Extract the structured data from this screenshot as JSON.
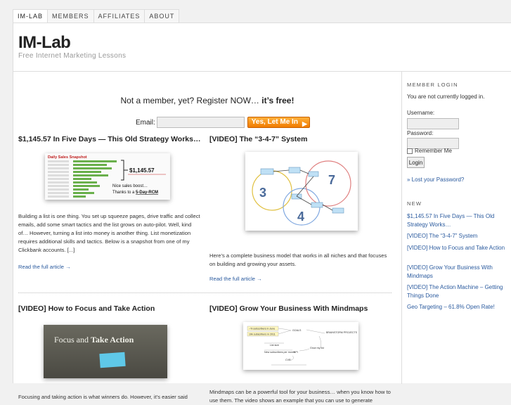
{
  "nav": {
    "tabs": [
      "IM-LAB",
      "MEMBERS",
      "AFFILIATES",
      "ABOUT"
    ]
  },
  "site": {
    "title": "IM-Lab",
    "description": "Free Internet Marketing Lessons"
  },
  "signup": {
    "text_prefix": "Not a member, yet? Register NOW… ",
    "text_bold": "it’s free!",
    "email_label": "Email:",
    "email_value": "",
    "button_label": "Yes, Let Me In",
    "button_icon": "arrow-right-icon"
  },
  "posts": [
    {
      "title": "$1,145.57 In Five Days — This Old Strategy Works…",
      "excerpt": "Building a list is one thing. You set up squeeze pages, drive traffic and collect emails, add some smart tactics and the list grows on auto-pilot. Well, kind of… However, turning a list into money is another thing. List monetization requires additional skills and tactics. Below is a snapshot from one of my Clickbank accounts. [...]",
      "read_more": "Read the full article →",
      "image": {
        "heading": "Daily Sales Snapshot",
        "amount": "$1,145.57",
        "note_line1": "Nice sales boost…",
        "note_line2": "Thanks to a ",
        "note_link": "5-Day-RCM"
      }
    },
    {
      "title": "[VIDEO] The “3-4-7” System",
      "excerpt": "Here’s a complete business model that works in all niches and that focuses on building and growing your assets.",
      "read_more": "Read the full article →",
      "image": {
        "n1": "3",
        "n2": "4",
        "n3": "7"
      }
    },
    {
      "title": "[VIDEO] How to Focus and Take Action",
      "excerpt": "Focusing and taking action is what winners do. However, it’s easier said",
      "read_more": "",
      "image": {
        "text_plain": "Focus and ",
        "text_bold": "Take Action"
      }
    },
    {
      "title": "[VIDEO] Grow Your Business With Mindmaps",
      "excerpt": "Mindmaps can be a powerful tool for your business… when you know how to use them. The video shows an example that you can use to generate",
      "read_more": "",
      "image": {
        "nodes": [
          "~% subscribers in June",
          "10k subscribers in 2011",
          "GOALS",
          "BRAINSTORM PROJECTS",
          "List size",
          "New subscribers per month",
          "Grow my list",
          "KPI",
          "CVR"
        ]
      }
    }
  ],
  "sidebar": {
    "login_heading": "Member Login",
    "login_status": "You are not currently logged in.",
    "username_label": "Username:",
    "password_label": "Password:",
    "remember_label": "Remember Me",
    "login_button": "Login",
    "lost_password": "» Lost your Password?",
    "new_heading": "New",
    "new_links": [
      "$1,145.57 In Five Days — This Old Strategy Works…",
      "[VIDEO] The “3-4-7” System",
      "[VIDEO] How to Focus and Take Action",
      "[VIDEO] Grow Your Business With Mindmaps",
      "[VIDEO] The Action Machine – Getting Things Done",
      "Geo Targeting – 61.8% Open Rate!"
    ]
  },
  "colors": {
    "link": "#2a5a9e",
    "button_orange": "#f07b00",
    "accent_green": "#6ab04c"
  }
}
